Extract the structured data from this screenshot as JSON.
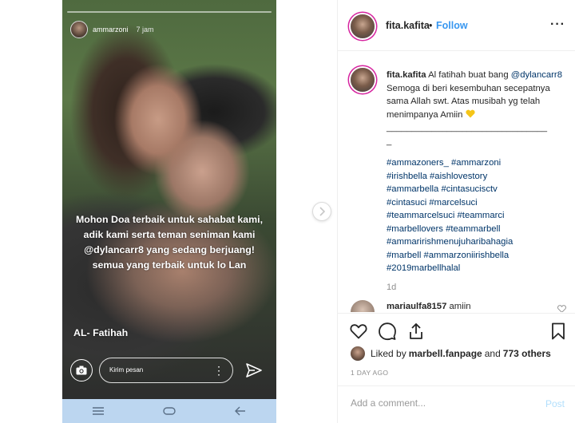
{
  "story": {
    "username": "ammarzoni",
    "time": "7 jam",
    "overlay_text": "Mohon Doa terbaik untuk sahabat kami, adik kami serta teman seniman kami @dylancarr8 yang sedang berjuang! semua yang terbaik untuk lo Lan",
    "signoff": "AL- Fatihah",
    "reply_placeholder": "Kirim pesan",
    "reply_more": "⋮"
  },
  "post": {
    "username": "fita.kafita",
    "separator": "•",
    "follow_label": "Follow",
    "more_label": "···"
  },
  "caption": {
    "username": "fita.kafita",
    "text_part1": "Al fatihah buat bang",
    "mention": "@dylancarr8",
    "text_part2": "Semoga di beri kesembuhan secepatnya sama Allah swt. Atas musibah yg telah menimpanya Amiin",
    "divider": "________________________________",
    "divider_tail": "_",
    "hashtags": [
      "#ammazoners_ #ammarzoni",
      "#irishbella #aishlovestory",
      "#ammarbella #cintasucisctv",
      "#cintasuci #marcelsuci",
      "#teammarcelsuci #teammarci",
      "#marbellovers #teammarbell",
      "#ammaririshmenujuharibahagia",
      "#marbell #ammarzoniirishbella",
      "#2019marbellhalal"
    ],
    "time": "1d"
  },
  "comments": [
    {
      "username": "mariaulfa8157",
      "text": "amiin"
    }
  ],
  "likes": {
    "prefix": "Liked by",
    "liker": "marbell.fanpage",
    "suffix": "and",
    "others": "773 others"
  },
  "date": "1 DAY AGO",
  "add_comment": {
    "placeholder": "Add a comment...",
    "post_label": "Post"
  },
  "colors": {
    "link": "#003569",
    "follow": "#3897f0",
    "muted": "#8e8e8e",
    "post_disabled": "#b2dffc",
    "heart_emoji": "#f5c518",
    "android_nav": "#bcd6f0"
  },
  "icons": {
    "camera": "camera-icon",
    "send": "send-icon",
    "like": "heart-outline-icon",
    "comment": "comment-icon",
    "share": "share-icon",
    "save": "bookmark-icon",
    "next": "chevron-right-icon"
  }
}
